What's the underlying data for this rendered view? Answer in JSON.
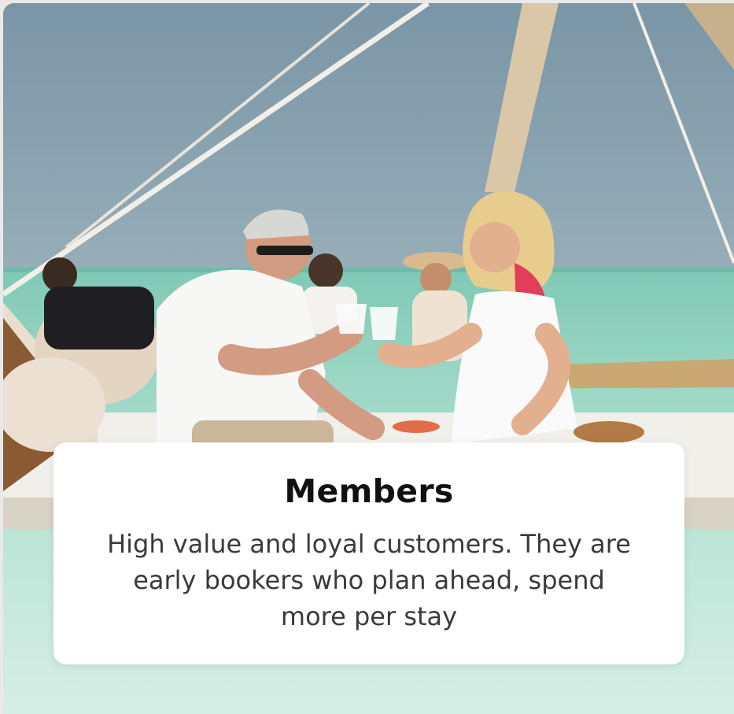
{
  "card": {
    "title": "Members",
    "description": "High value and loyal customers. They are early bookers who plan ahead, spend more per stay"
  },
  "colors": {
    "sky": "#8aa2b0",
    "sea": "#a9dcc9",
    "card_bg": "#ffffff",
    "title_color": "#111111",
    "text_color": "#3a3a3a"
  }
}
